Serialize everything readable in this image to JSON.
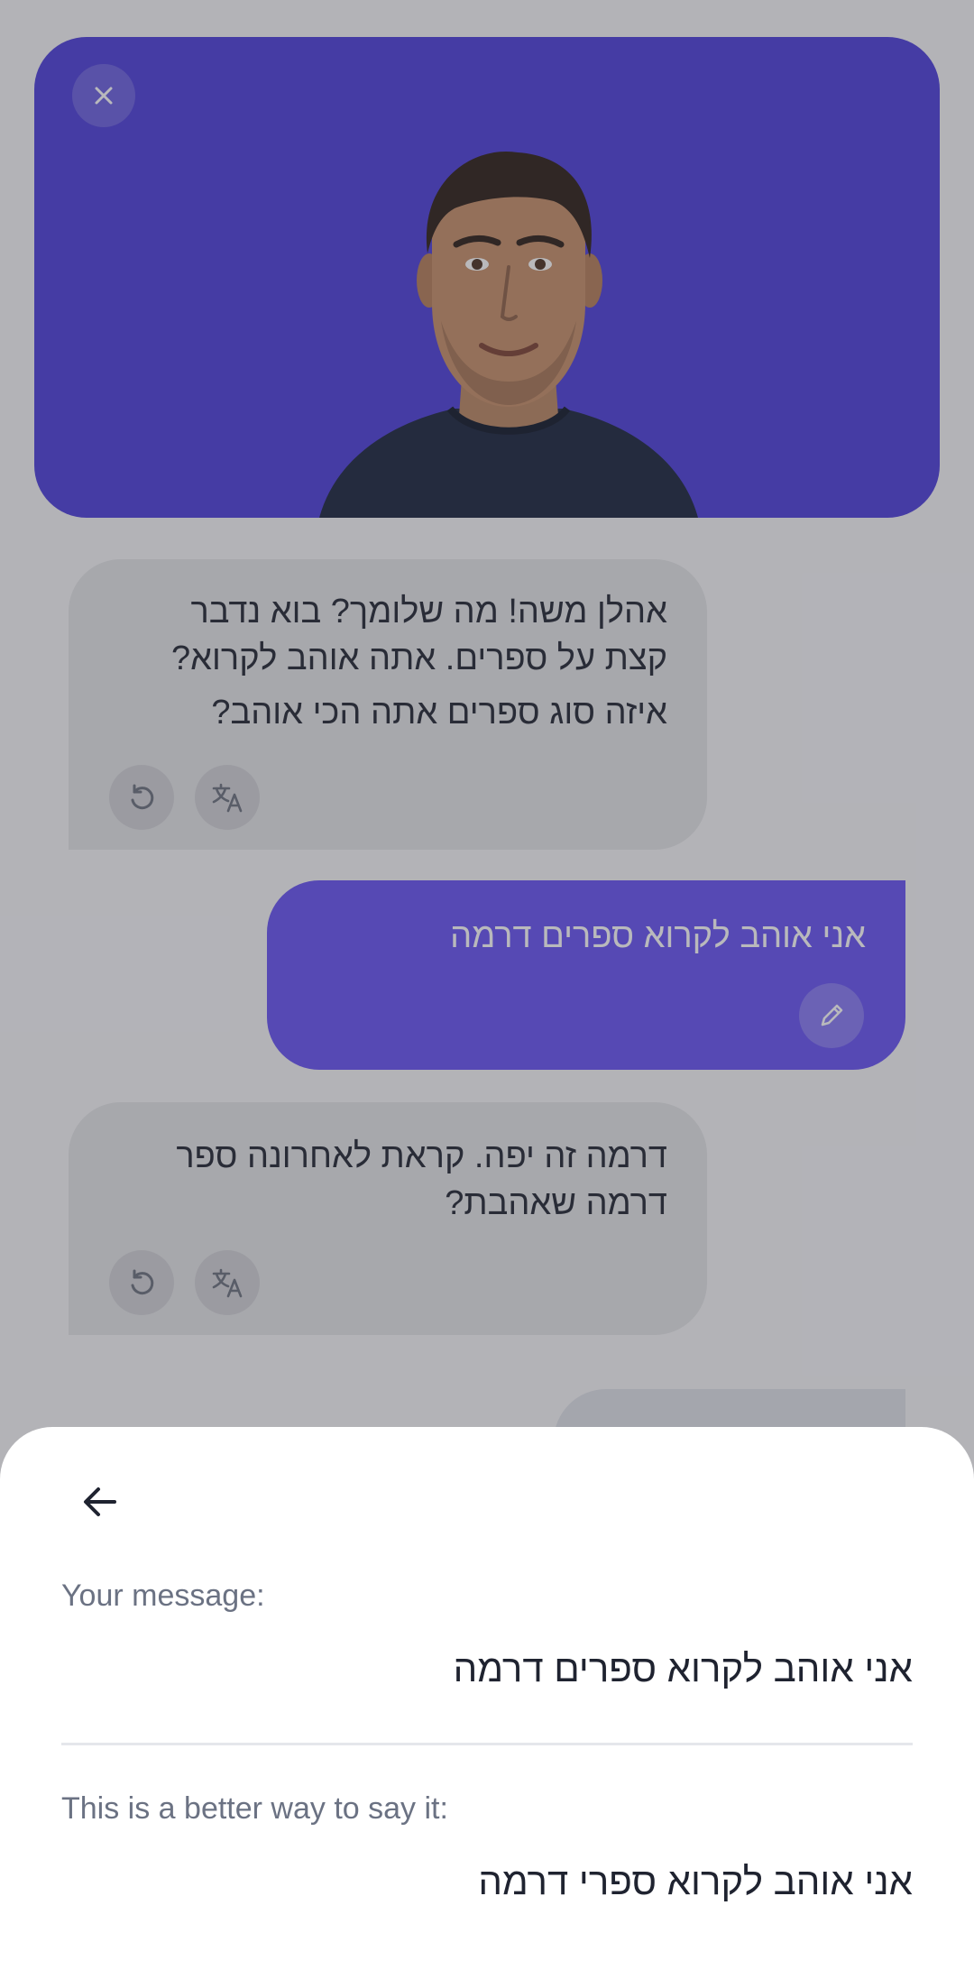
{
  "chat": {
    "messages": [
      {
        "role": "bot",
        "lines": [
          "אהלן משה! מה שלומך? בוא נדבר",
          "קצת על ספרים. אתה אוהב לקרוא?",
          "איזה סוג ספרים אתה הכי אוהב?"
        ]
      },
      {
        "role": "user",
        "lines": [
          "אני אוהב לקרוא ספרים דרמה"
        ]
      },
      {
        "role": "bot",
        "lines": [
          "דרמה זה יפה. קראת לאחרונה ספר",
          "דרמה שאהבת?"
        ]
      }
    ]
  },
  "icons": {
    "close": "close-icon",
    "replay": "replay-icon",
    "translate": "translate-icon",
    "edit": "pencil-icon",
    "back": "arrow-left-icon"
  },
  "sheet": {
    "your_message_label": "Your message:",
    "your_message": "אני אוהב לקרוא ספרים דרמה",
    "better_label": "This is a better way to say it:",
    "better_message": "אני אוהב לקרוא ספרי דרמה"
  },
  "colors": {
    "hero_bg": "#4a3cd9",
    "user_bubble": "#6451f3",
    "bot_bubble": "#e3e4e6"
  }
}
